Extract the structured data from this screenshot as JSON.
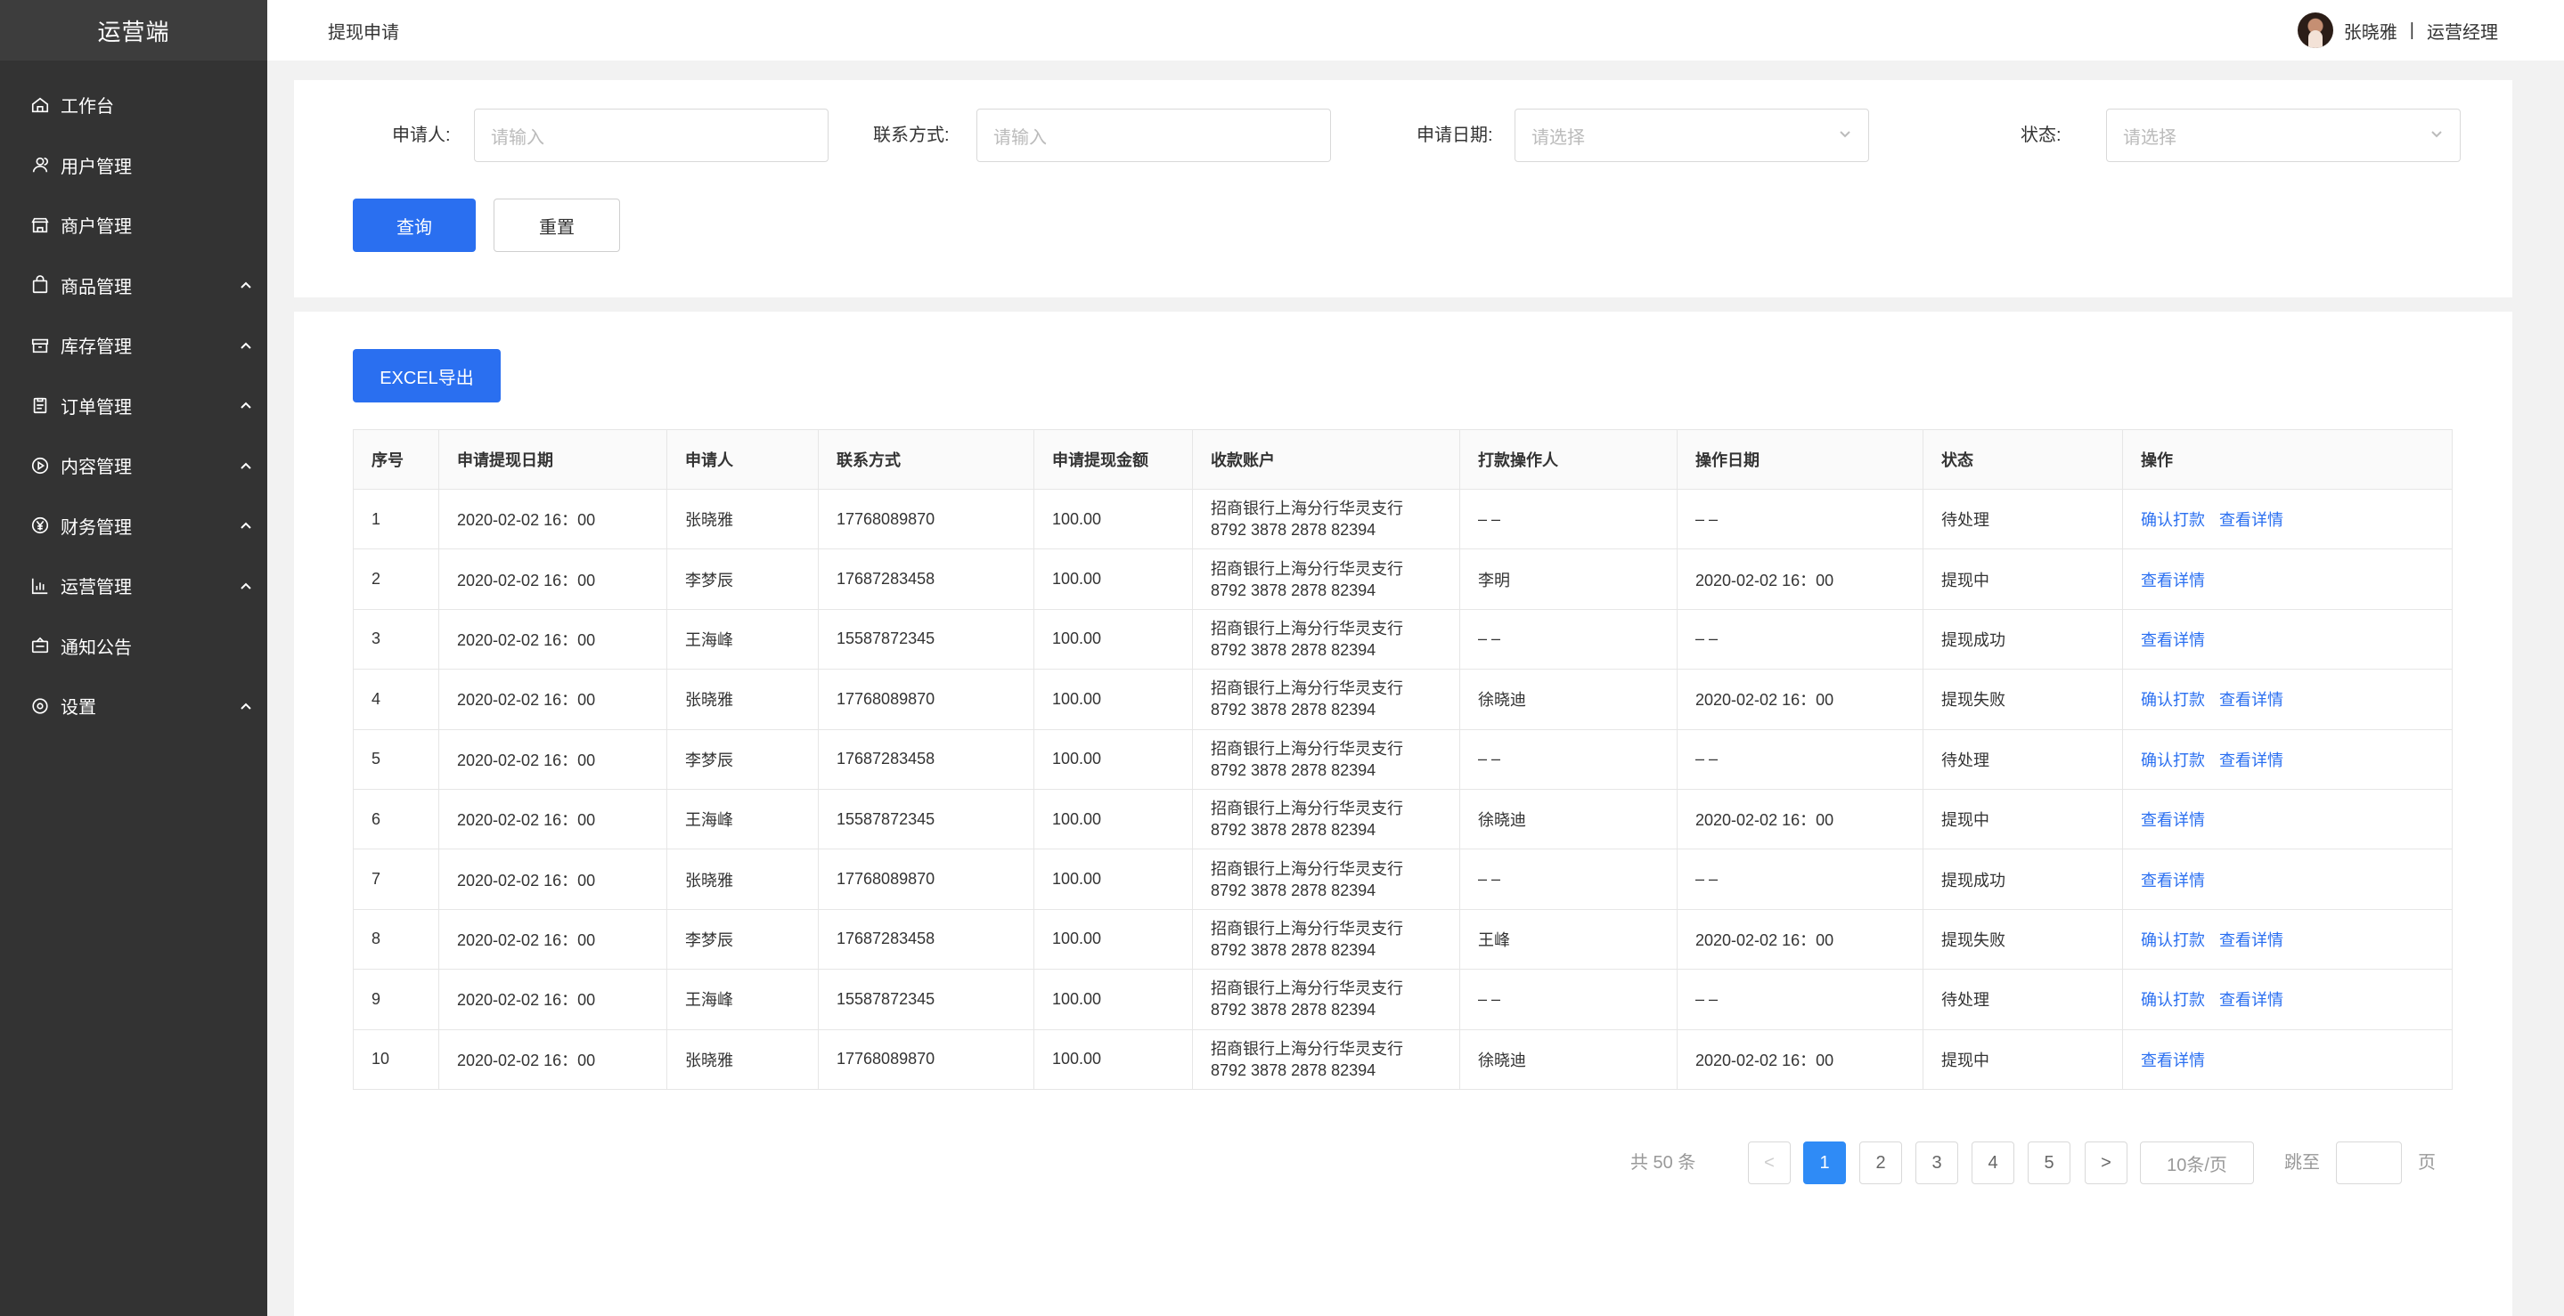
{
  "app": {
    "brand": "运营端"
  },
  "sidebar": {
    "items": [
      {
        "label": "工作台",
        "icon": "home-icon",
        "expandable": false
      },
      {
        "label": "用户管理",
        "icon": "user-icon",
        "expandable": false
      },
      {
        "label": "商户管理",
        "icon": "store-icon",
        "expandable": false
      },
      {
        "label": "商品管理",
        "icon": "bag-icon",
        "expandable": true
      },
      {
        "label": "库存管理",
        "icon": "box-icon",
        "expandable": true
      },
      {
        "label": "订单管理",
        "icon": "clipboard-icon",
        "expandable": true
      },
      {
        "label": "内容管理",
        "icon": "play-circle-icon",
        "expandable": true
      },
      {
        "label": "财务管理",
        "icon": "yen-circle-icon",
        "expandable": true
      },
      {
        "label": "运营管理",
        "icon": "bar-chart-icon",
        "expandable": true
      },
      {
        "label": "通知公告",
        "icon": "notice-icon",
        "expandable": false
      },
      {
        "label": "设置",
        "icon": "gear-icon",
        "expandable": true
      }
    ]
  },
  "header": {
    "title": "提现申请",
    "user_name": "张晓雅",
    "separator": "|",
    "user_role": "运营经理"
  },
  "filters": {
    "applicant_label": "申请人:",
    "applicant_placeholder": "请输入",
    "contact_label": "联系方式:",
    "contact_placeholder": "请输入",
    "date_label": "申请日期:",
    "date_placeholder": "请选择",
    "status_label": "状态:",
    "status_placeholder": "请选择",
    "query_label": "查询",
    "reset_label": "重置"
  },
  "toolbar": {
    "export_label": "EXCEL导出"
  },
  "table": {
    "columns": [
      "序号",
      "申请提现日期",
      "申请人",
      "联系方式",
      "申请提现金额",
      "收款账户",
      "打款操作人",
      "操作日期",
      "状态",
      "操作"
    ],
    "rows": [
      {
        "no": "1",
        "date": "2020-02-02 16：00",
        "applicant": "张晓雅",
        "phone": "17768089870",
        "amount": "100.00",
        "bank": "招商银行上海分行华灵支行",
        "account": "8792 3878 2878  82394",
        "operator": "– –",
        "op_date": "– –",
        "status": "待处理",
        "actions": [
          "确认打款",
          "查看详情"
        ]
      },
      {
        "no": "2",
        "date": "2020-02-02 16：00",
        "applicant": "李梦辰",
        "phone": "17687283458",
        "amount": "100.00",
        "bank": "招商银行上海分行华灵支行",
        "account": "8792 3878 2878  82394",
        "operator": "李明",
        "op_date": "2020-02-02 16：00",
        "status": "提现中",
        "actions": [
          "查看详情"
        ]
      },
      {
        "no": "3",
        "date": "2020-02-02 16：00",
        "applicant": "王海峰",
        "phone": "15587872345",
        "amount": "100.00",
        "bank": "招商银行上海分行华灵支行",
        "account": "8792 3878 2878  82394",
        "operator": "– –",
        "op_date": "– –",
        "status": "提现成功",
        "actions": [
          "查看详情"
        ]
      },
      {
        "no": "4",
        "date": "2020-02-02 16：00",
        "applicant": "张晓雅",
        "phone": "17768089870",
        "amount": "100.00",
        "bank": "招商银行上海分行华灵支行",
        "account": "8792 3878 2878  82394",
        "operator": "徐晓迪",
        "op_date": "2020-02-02 16：00",
        "status": "提现失败",
        "actions": [
          "确认打款",
          "查看详情"
        ]
      },
      {
        "no": "5",
        "date": "2020-02-02 16：00",
        "applicant": "李梦辰",
        "phone": "17687283458",
        "amount": "100.00",
        "bank": "招商银行上海分行华灵支行",
        "account": "8792 3878 2878  82394",
        "operator": "– –",
        "op_date": "– –",
        "status": "待处理",
        "actions": [
          "确认打款",
          "查看详情"
        ]
      },
      {
        "no": "6",
        "date": "2020-02-02 16：00",
        "applicant": "王海峰",
        "phone": "15587872345",
        "amount": "100.00",
        "bank": "招商银行上海分行华灵支行",
        "account": "8792 3878 2878  82394",
        "operator": "徐晓迪",
        "op_date": "2020-02-02 16：00",
        "status": "提现中",
        "actions": [
          "查看详情"
        ]
      },
      {
        "no": "7",
        "date": "2020-02-02 16：00",
        "applicant": "张晓雅",
        "phone": "17768089870",
        "amount": "100.00",
        "bank": "招商银行上海分行华灵支行",
        "account": "8792 3878 2878  82394",
        "operator": "– –",
        "op_date": "– –",
        "status": "提现成功",
        "actions": [
          "查看详情"
        ]
      },
      {
        "no": "8",
        "date": "2020-02-02 16：00",
        "applicant": "李梦辰",
        "phone": "17687283458",
        "amount": "100.00",
        "bank": "招商银行上海分行华灵支行",
        "account": "8792 3878 2878  82394",
        "operator": "王峰",
        "op_date": "2020-02-02 16：00",
        "status": "提现失败",
        "actions": [
          "确认打款",
          "查看详情"
        ]
      },
      {
        "no": "9",
        "date": "2020-02-02 16：00",
        "applicant": "王海峰",
        "phone": "15587872345",
        "amount": "100.00",
        "bank": "招商银行上海分行华灵支行",
        "account": "8792 3878 2878  82394",
        "operator": "– –",
        "op_date": "– –",
        "status": "待处理",
        "actions": [
          "确认打款",
          "查看详情"
        ]
      },
      {
        "no": "10",
        "date": "2020-02-02 16：00",
        "applicant": "张晓雅",
        "phone": "17768089870",
        "amount": "100.00",
        "bank": "招商银行上海分行华灵支行",
        "account": "8792 3878 2878  82394",
        "operator": "徐晓迪",
        "op_date": "2020-02-02 16：00",
        "status": "提现中",
        "actions": [
          "查看详情"
        ]
      }
    ]
  },
  "pagination": {
    "total": "共 50 条",
    "prev": "<",
    "pages": [
      "1",
      "2",
      "3",
      "4",
      "5"
    ],
    "current": "1",
    "next": ">",
    "page_size": "10条/页",
    "jump_label": "跳至",
    "jump_value": "",
    "page_unit": "页"
  },
  "colors": {
    "sidebar_bg": "#333333",
    "brand_bg": "#3d3d3d",
    "primary": "#2a6ff0",
    "page_active": "#2f8bf6",
    "link": "#2a6ff0"
  }
}
